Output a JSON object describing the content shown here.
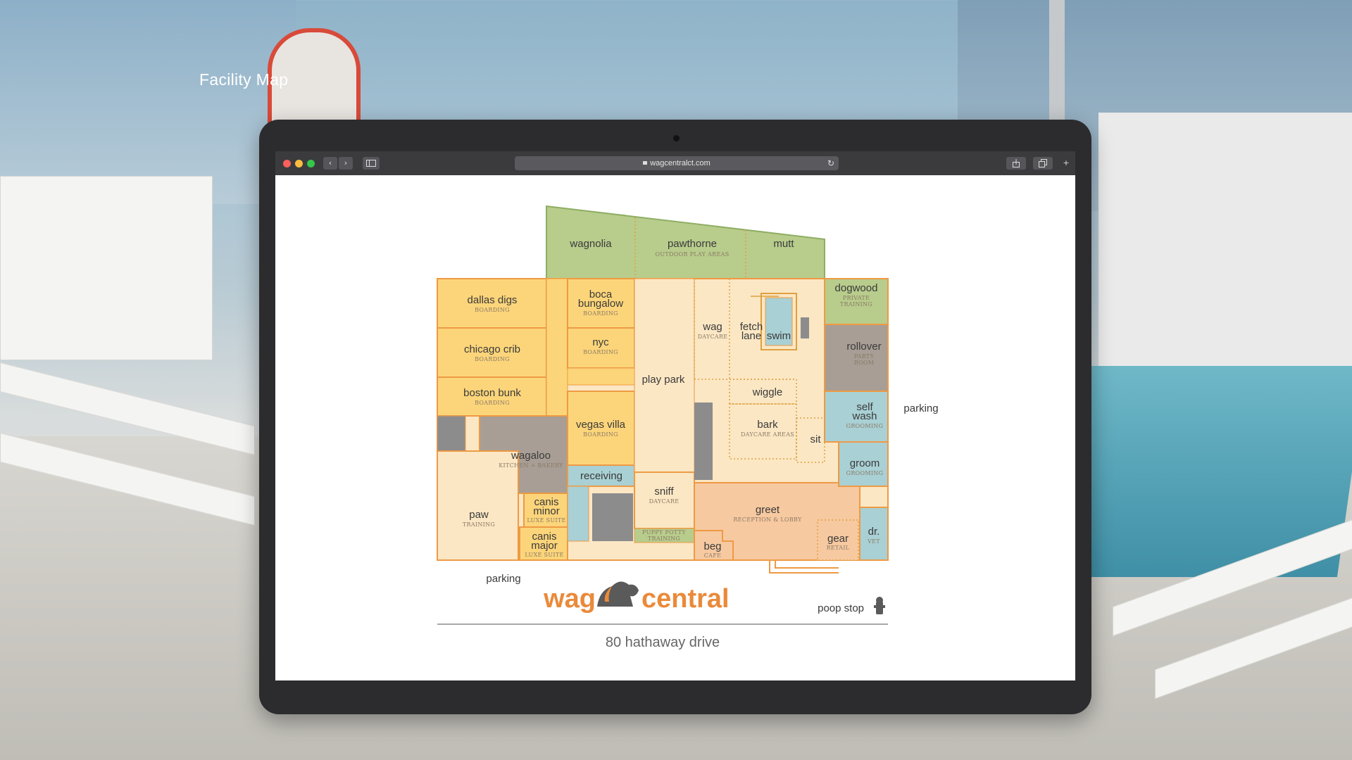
{
  "page_title": "Facility Map",
  "browser": {
    "url": "wagcentralct.com",
    "back": "‹",
    "forward": "›"
  },
  "map": {
    "brand_left": "wag",
    "brand_right": "central",
    "address": "80 hathaway drive",
    "poop_stop": "poop stop",
    "parking_bottom": "parking",
    "parking_right": "parking",
    "zones": {
      "wagnolia": {
        "name": "wagnolia"
      },
      "pawthorne": {
        "name": "pawthorne",
        "sub": "OUTDOOR PLAY AREAS"
      },
      "mutt": {
        "name": "mutt"
      },
      "dogwood": {
        "name": "dogwood",
        "sub1": "PRIVATE",
        "sub2": "TRAINING"
      },
      "dallas_digs": {
        "name": "dallas digs",
        "sub": "BOARDING"
      },
      "chicago_crib": {
        "name": "chicago crib",
        "sub": "BOARDING"
      },
      "boston_bunk": {
        "name": "boston bunk",
        "sub": "BOARDING"
      },
      "boca_bungalow": {
        "name1": "boca",
        "name2": "bungalow",
        "sub": "BOARDING"
      },
      "nyc": {
        "name": "nyc",
        "sub": "BOARDING"
      },
      "vegas_villa": {
        "name": "vegas villa",
        "sub": "BOARDING"
      },
      "play_park": {
        "name": "play park"
      },
      "wag": {
        "name": "wag",
        "sub": "DAYCARE"
      },
      "fetch_lane": {
        "name1": "fetch",
        "name2": "lane"
      },
      "swim": {
        "name": "swim"
      },
      "rollover": {
        "name": "rollover",
        "sub1": "PARTY",
        "sub2": "ROOM"
      },
      "wiggle": {
        "name": "wiggle"
      },
      "bark": {
        "name": "bark",
        "sub": "DAYCARE AREAS"
      },
      "sit": {
        "name": "sit"
      },
      "self_wash": {
        "name1": "self",
        "name2": "wash",
        "sub": "GROOMING"
      },
      "groom": {
        "name": "groom",
        "sub": "GROOMING"
      },
      "wagaloo": {
        "name": "wagaloo",
        "sub": "KITCHEN + BAKERY"
      },
      "receiving": {
        "name": "receiving"
      },
      "sniff": {
        "name": "sniff",
        "sub": "DAYCARE"
      },
      "puppy_potty": {
        "sub1": "PUPPY POTTY",
        "sub2": "TRAINING"
      },
      "paw": {
        "name": "paw",
        "sub": "TRAINING"
      },
      "canis_minor": {
        "name1": "canis",
        "name2": "minor",
        "sub": "LUXE SUITE"
      },
      "canis_major": {
        "name1": "canis",
        "name2": "major",
        "sub": "LUXE SUITE"
      },
      "greet": {
        "name": "greet",
        "sub": "RECEPTION & LOBBY"
      },
      "beg": {
        "name": "beg",
        "sub": "CAFE"
      },
      "gear": {
        "name": "gear",
        "sub": "RETAIL"
      },
      "dr": {
        "name": "dr.",
        "sub": "VET"
      }
    },
    "colors": {
      "green": "#b8cc8c",
      "boarding": "#fcd57a",
      "cream": "#fbe7c4",
      "gray": "#a89e95",
      "dark_gray": "#8c8c8c",
      "teal": "#a9d0d4",
      "peach": "#f7c9a0",
      "orange_stroke": "#ee9a44",
      "brand_orange": "#ea8a3a"
    }
  }
}
